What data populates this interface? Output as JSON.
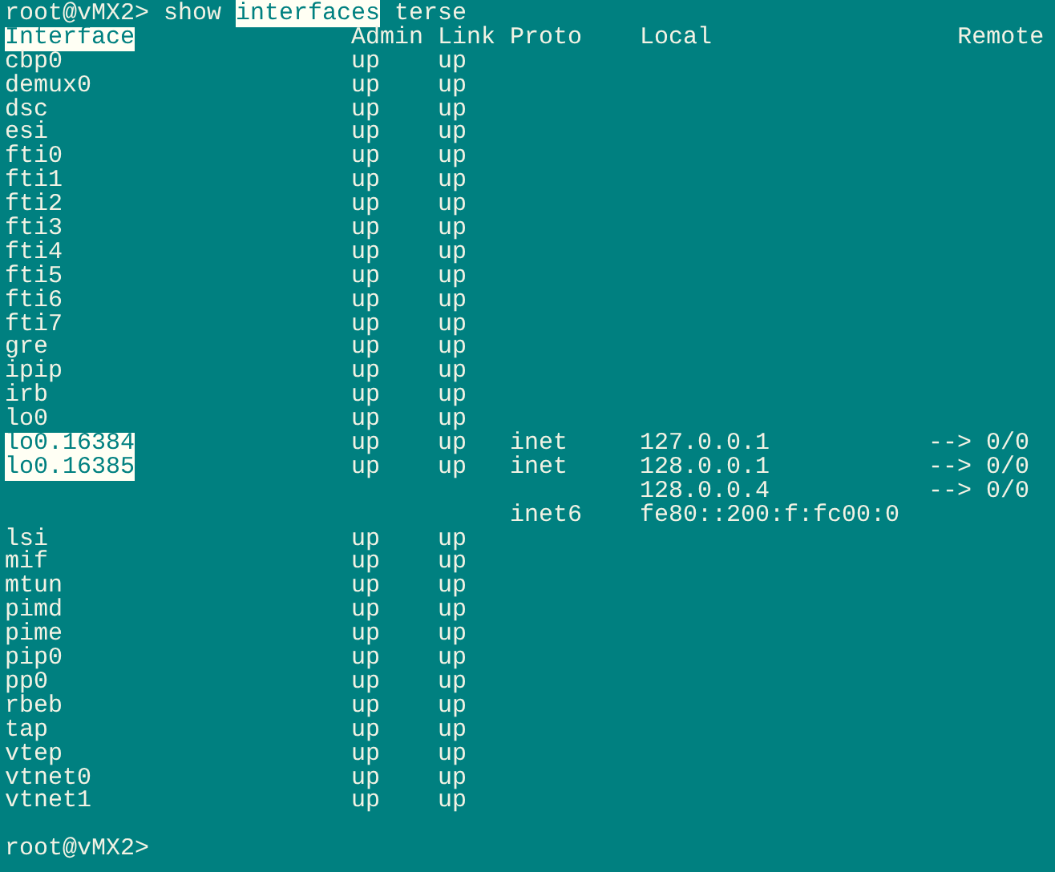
{
  "command": [
    {
      "text": "root@vMX2> show ",
      "highlighted": false
    },
    {
      "text": "interfaces",
      "highlighted": true
    },
    {
      "text": " terse",
      "highlighted": false
    }
  ],
  "table": {
    "columns": [
      {
        "label": "Interface",
        "highlighted": true
      },
      {
        "label": "Admin",
        "highlighted": false
      },
      {
        "label": "Link",
        "highlighted": false
      },
      {
        "label": "Proto",
        "highlighted": false
      },
      {
        "label": "Local",
        "highlighted": false
      },
      {
        "label": "Remote",
        "highlighted": false
      }
    ],
    "rows": [
      {
        "interface": "cbp0",
        "admin": "up",
        "link": "up",
        "highlighted": false
      },
      {
        "interface": "demux0",
        "admin": "up",
        "link": "up",
        "highlighted": false
      },
      {
        "interface": "dsc",
        "admin": "up",
        "link": "up",
        "highlighted": false
      },
      {
        "interface": "esi",
        "admin": "up",
        "link": "up",
        "highlighted": false
      },
      {
        "interface": "fti0",
        "admin": "up",
        "link": "up",
        "highlighted": false
      },
      {
        "interface": "fti1",
        "admin": "up",
        "link": "up",
        "highlighted": false
      },
      {
        "interface": "fti2",
        "admin": "up",
        "link": "up",
        "highlighted": false
      },
      {
        "interface": "fti3",
        "admin": "up",
        "link": "up",
        "highlighted": false
      },
      {
        "interface": "fti4",
        "admin": "up",
        "link": "up",
        "highlighted": false
      },
      {
        "interface": "fti5",
        "admin": "up",
        "link": "up",
        "highlighted": false
      },
      {
        "interface": "fti6",
        "admin": "up",
        "link": "up",
        "highlighted": false
      },
      {
        "interface": "fti7",
        "admin": "up",
        "link": "up",
        "highlighted": false
      },
      {
        "interface": "gre",
        "admin": "up",
        "link": "up",
        "highlighted": false
      },
      {
        "interface": "ipip",
        "admin": "up",
        "link": "up",
        "highlighted": false
      },
      {
        "interface": "irb",
        "admin": "up",
        "link": "up",
        "highlighted": false
      },
      {
        "interface": "lo0",
        "admin": "up",
        "link": "up",
        "highlighted": false
      },
      {
        "interface": "lo0.16384",
        "admin": "up",
        "link": "up",
        "proto": "inet",
        "local": "127.0.0.1",
        "remote": "--> 0/0",
        "highlighted": true
      },
      {
        "interface": "lo0.16385",
        "admin": "up",
        "link": "up",
        "proto": "inet",
        "local": "128.0.0.1",
        "remote": "--> 0/0",
        "highlighted": true
      },
      {
        "local": "128.0.0.4",
        "remote": "--> 0/0",
        "highlighted": false
      },
      {
        "proto": "inet6",
        "local": "fe80::200:f:fc00:0",
        "highlighted": false
      },
      {
        "interface": "lsi",
        "admin": "up",
        "link": "up",
        "highlighted": false
      },
      {
        "interface": "mif",
        "admin": "up",
        "link": "up",
        "highlighted": false
      },
      {
        "interface": "mtun",
        "admin": "up",
        "link": "up",
        "highlighted": false
      },
      {
        "interface": "pimd",
        "admin": "up",
        "link": "up",
        "highlighted": false
      },
      {
        "interface": "pime",
        "admin": "up",
        "link": "up",
        "highlighted": false
      },
      {
        "interface": "pip0",
        "admin": "up",
        "link": "up",
        "highlighted": false
      },
      {
        "interface": "pp0",
        "admin": "up",
        "link": "up",
        "highlighted": false
      },
      {
        "interface": "rbeb",
        "admin": "up",
        "link": "up",
        "highlighted": false
      },
      {
        "interface": "tap",
        "admin": "up",
        "link": "up",
        "highlighted": false
      },
      {
        "interface": "vtep",
        "admin": "up",
        "link": "up",
        "highlighted": false
      },
      {
        "interface": "vtnet0",
        "admin": "up",
        "link": "up",
        "highlighted": false
      },
      {
        "interface": "vtnet1",
        "admin": "up",
        "link": "up",
        "highlighted": false
      }
    ]
  },
  "prompt": "root@vMX2>"
}
